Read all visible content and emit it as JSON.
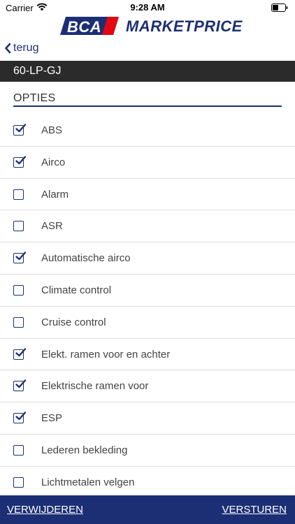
{
  "status_bar": {
    "carrier": "Carrier",
    "time": "9:28 AM"
  },
  "brand": {
    "bca": "BCA",
    "name": "MARKETPRICE",
    "color": "#1c2f74",
    "accent": "#e30613"
  },
  "nav": {
    "back_label": "terug"
  },
  "vehicle": {
    "plate": "60-LP-GJ"
  },
  "section": {
    "title": "OPTIES"
  },
  "options": [
    {
      "label": "ABS",
      "checked": true
    },
    {
      "label": "Airco",
      "checked": true
    },
    {
      "label": "Alarm",
      "checked": false
    },
    {
      "label": "ASR",
      "checked": false
    },
    {
      "label": "Automatische airco",
      "checked": true
    },
    {
      "label": "Climate control",
      "checked": false
    },
    {
      "label": "Cruise control",
      "checked": false
    },
    {
      "label": "Elekt. ramen voor en achter",
      "checked": true
    },
    {
      "label": "Elektrische ramen voor",
      "checked": true
    },
    {
      "label": "ESP",
      "checked": true
    },
    {
      "label": "Lederen bekleding",
      "checked": false
    },
    {
      "label": "Lichtmetalen velgen",
      "checked": false
    }
  ],
  "footer": {
    "delete_label": "VERWIJDEREN",
    "send_label": "VERSTUREN"
  }
}
